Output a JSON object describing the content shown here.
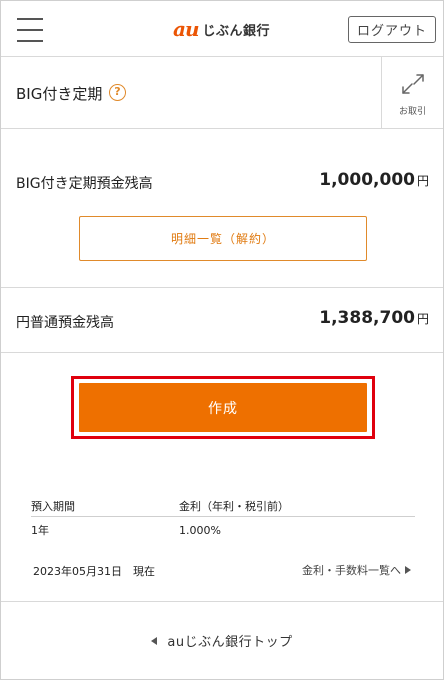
{
  "header": {
    "logo_mark": "au",
    "logo_text": "じぶん銀行",
    "logout_label": "ログアウト"
  },
  "title_row": {
    "title": "BIG付き定期",
    "help_symbol": "?",
    "torihiki_label": "お取引"
  },
  "balances": {
    "big_label": "BIG付き定期預金残高",
    "big_value": "1,000,000",
    "yen_label": "円普通預金残高",
    "yen_value": "1,388,700",
    "unit": "円"
  },
  "detail_button": "明細一覧（解約）",
  "create_button": "作成",
  "rate_table": {
    "headers": [
      "預入期間",
      "金利（年利・税引前）"
    ],
    "rows": [
      [
        "1年",
        "1.000%"
      ]
    ]
  },
  "as_of": "2023年05月31日　現在",
  "rate_link": "金利・手数料一覧へ",
  "footer_link": "auじぶん銀行トップ",
  "colors": {
    "brand": "#eb5505",
    "primary_button": "#ee7000",
    "highlight_outline": "#e0000d"
  },
  "icons": [
    "menu-icon",
    "help-icon",
    "transfer-arrows-icon",
    "chevron-right-icon",
    "chevron-left-icon"
  ]
}
